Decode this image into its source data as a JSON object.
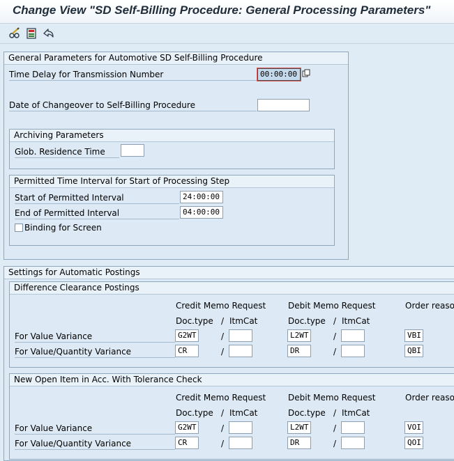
{
  "title": "Change View \"SD Self-Billing Procedure: General Processing Parameters\"",
  "toolbar": {
    "icons": [
      "glasses-pencil-icon",
      "save-local-icon",
      "undo-icon"
    ]
  },
  "general": {
    "header": "General Parameters for Automotive SD Self-Billing Procedure",
    "time_delay_label": "Time Delay for Transmission Number",
    "time_delay_value": "00:00:00",
    "changeover_label": "Date of Changeover to Self-Billing Procedure",
    "changeover_value": "",
    "archiving": {
      "header": "Archiving Parameters",
      "residence_label": "Glob. Residence Time",
      "residence_value": ""
    },
    "interval": {
      "header": "Permitted Time Interval for Start of Processing Step",
      "start_label": "Start of Permitted Interval",
      "start_value": "24:00:00",
      "end_label": "End of Permitted Interval",
      "end_value": "04:00:00",
      "binding_label": "Binding for Screen",
      "binding_checked": false
    }
  },
  "settings": {
    "header": "Settings for Automatic Postings",
    "diff": {
      "header": "Difference Clearance Postings",
      "credit_header": "Credit Memo Request",
      "debit_header": "Debit Memo Request",
      "order_header": "Order reason",
      "doctype": "Doc.type",
      "itmcat": "ItmCat",
      "slash": "/",
      "rows": [
        {
          "label": "For Value Variance",
          "credit_doc": "G2WT",
          "credit_itm": "",
          "debit_doc": "L2WT",
          "debit_itm": "",
          "order": "VBI"
        },
        {
          "label": "For Value/Quantity Variance",
          "credit_doc": "CR",
          "credit_itm": "",
          "debit_doc": "DR",
          "debit_itm": "",
          "order": "QBI"
        }
      ]
    },
    "openitem": {
      "header": "New Open Item in Acc. With Tolerance Check",
      "credit_header": "Credit Memo Request",
      "debit_header": "Debit Memo Request",
      "order_header": "Order reason",
      "doctype": "Doc.type",
      "itmcat": "ItmCat",
      "slash": "/",
      "rows": [
        {
          "label": "For Value Variance",
          "credit_doc": "G2WT",
          "credit_itm": "",
          "debit_doc": "L2WT",
          "debit_itm": "",
          "order": "VOI"
        },
        {
          "label": "For Value/Quantity Variance",
          "credit_doc": "CR",
          "credit_itm": "",
          "debit_doc": "DR",
          "debit_itm": "",
          "order": "QOI"
        }
      ]
    }
  }
}
